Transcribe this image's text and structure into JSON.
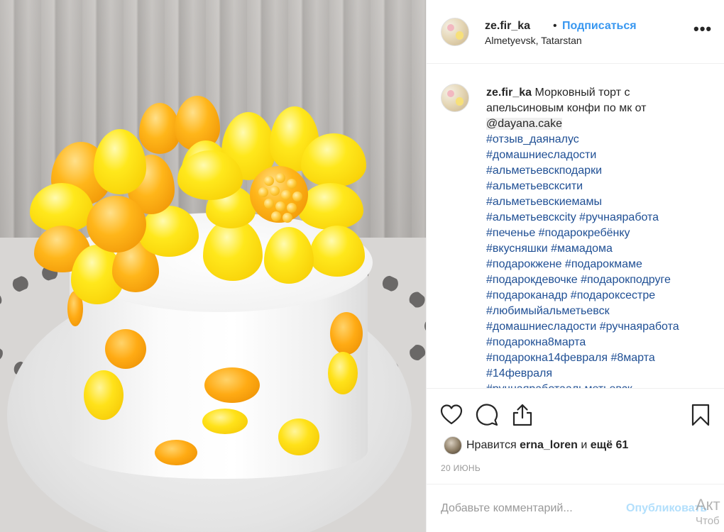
{
  "post": {
    "username": "ze.fir_ka",
    "separator": "•",
    "follow_label": "Подписаться",
    "location": "Almetyevsk, Tatarstan",
    "more_icon": "•••"
  },
  "caption": {
    "username": "ze.fir_ka",
    "text": "Морковный торт с апельсиновым конфи по мк от",
    "mention": "@dayana.cake",
    "hashtag_lines": [
      "#отзыв_даяналус",
      "#домашниесладости",
      "#альметьевскподарки",
      "#альметьевсксити",
      "#альметьевскиемамы",
      "#альметьевскcity #ручнаяработа",
      "#печенье #подарокребёнку",
      "#вкусняшки #мамадома",
      "#подарокжене #подарокмаме",
      "#подарокдевочке #подарокподруге",
      "#подароканадр #подароксестре",
      "#любимыйальметьевск",
      "#домашниесладости #ручнаяработа",
      "#подарокна8марта",
      "#подарокна14февраля #8марта",
      "#14февраля",
      "#ручнаяработаальметьевск"
    ]
  },
  "actions": {
    "like_icon": "heart-icon",
    "comment_icon": "comment-icon",
    "share_icon": "share-icon",
    "save_icon": "bookmark-icon"
  },
  "likes": {
    "prefix": "Нравится",
    "user": "erna_loren",
    "connector": "и",
    "others": "ещё 61"
  },
  "date": "20 ИЮНЬ",
  "comment_box": {
    "placeholder": "Добавьте комментарий...",
    "publish_label": "Опубликовать"
  },
  "watermark": {
    "line1": "Акт",
    "line2": "Чтоб"
  },
  "colors": {
    "accent": "#3897f0",
    "hashtag": "#1f4f94",
    "text": "#262626",
    "muted": "#999999",
    "publish_disabled": "#b2dffc"
  }
}
